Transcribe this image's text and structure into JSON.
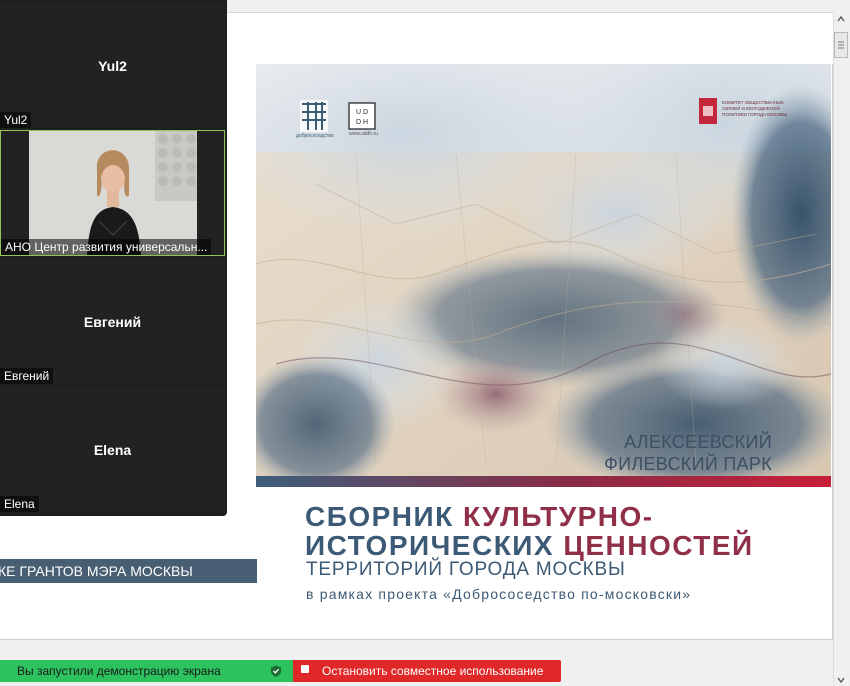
{
  "gallery": {
    "participants": [
      {
        "display_name": "Yul2",
        "label": "Yul2"
      },
      {
        "display_name": "",
        "label": "АНО Центр развития универсальн..."
      },
      {
        "display_name": "Евгений",
        "label": "Евгений"
      },
      {
        "display_name": "Elena",
        "label": "Elena"
      }
    ]
  },
  "document": {
    "banner": "КЕ ГРАНТОВ МЭРА МОСКВЫ",
    "slide": {
      "logo_left_caption": "добрососедство",
      "logo_mid_text": "U D\nD H",
      "logo_mid_caption": "www.uddh.ru",
      "committee_text": "КОМИТЕТ ОБЩЕСТВЕННЫХ СВЯЗЕЙ И МОЛОДЕЖНОЙ ПОЛИТИКИ ГОРОДА МОСКВЫ",
      "park_title_1": "АЛЕКСЕЕВСКИЙ",
      "park_title_2": "ФИЛЕВСКИЙ ПАРК",
      "title_line1_a": "СБОРНИК ",
      "title_line1_b": "КУЛЬТУРНО-",
      "title_line2_a": "ИСТОРИЧЕСКИХ ",
      "title_line2_b": "ЦЕННОСТЕЙ",
      "subtitle": "ТЕРРИТОРИЙ ГОРОДА МОСКВЫ",
      "project_line": "в рамках проекта «Добрососедство по-московски»"
    }
  },
  "share_bar": {
    "status": "Вы запустили демонстрацию экрана",
    "stop": "Остановить совместное использование"
  },
  "colors": {
    "status_green": "#2cc25e",
    "stop_red": "#e02828",
    "title_blue": "#3c5a76",
    "title_red": "#8f2f48"
  }
}
